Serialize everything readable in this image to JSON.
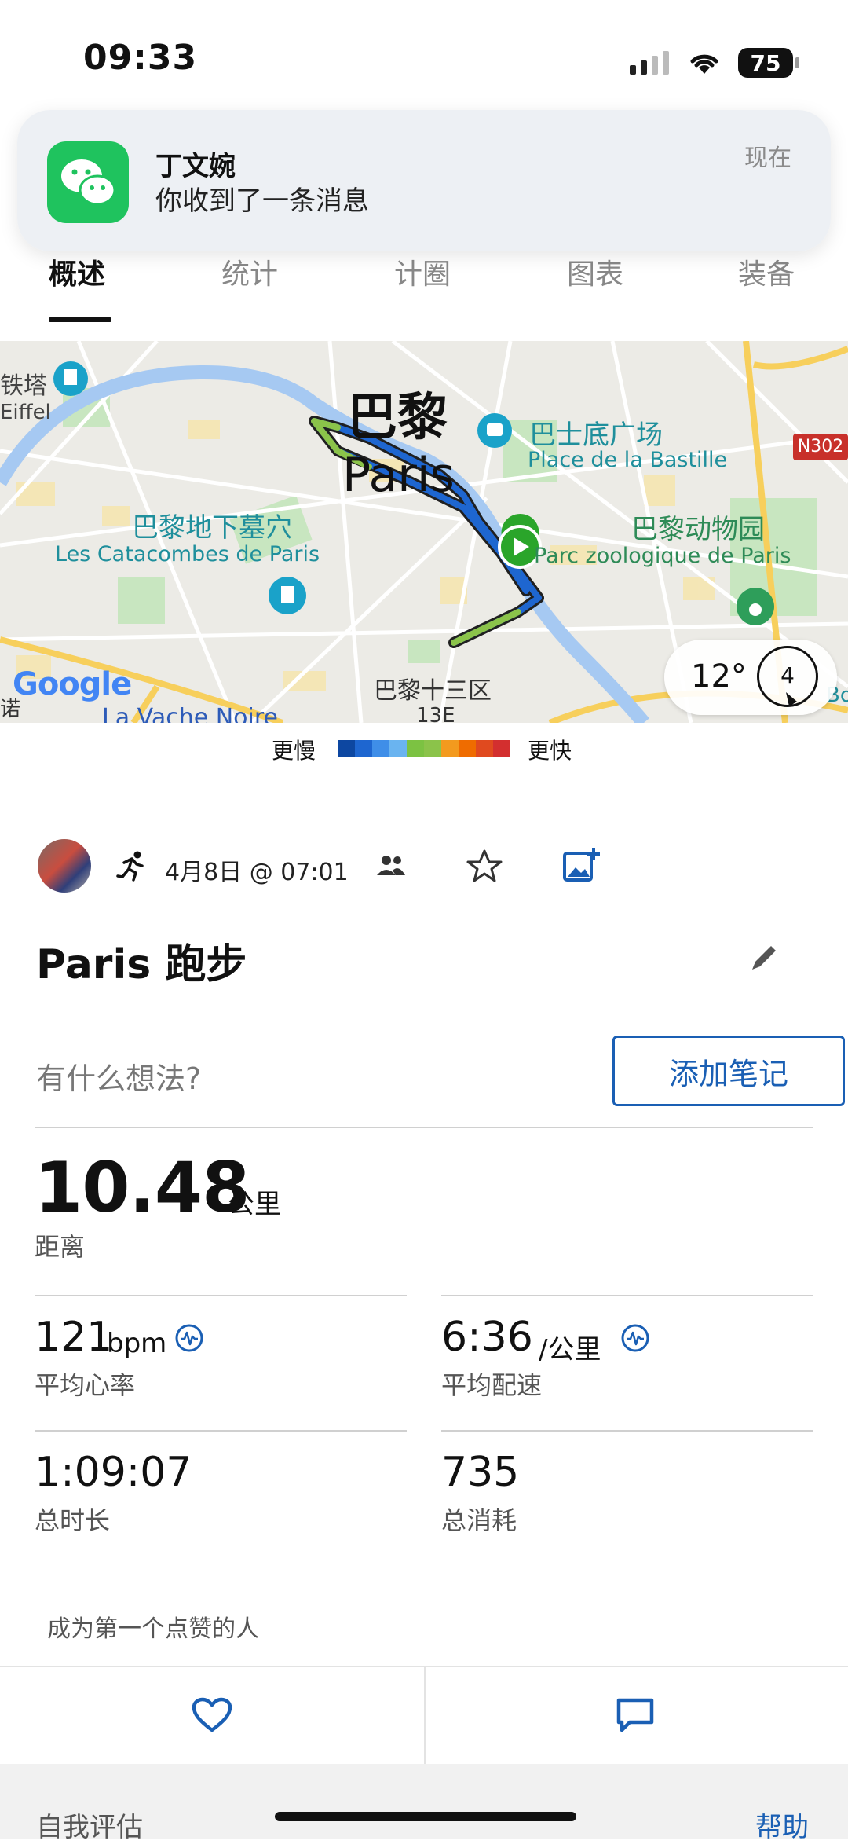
{
  "status_bar": {
    "time": "09:33",
    "battery": "75"
  },
  "notification": {
    "app_icon": "wechat-icon",
    "title": "丁文婉",
    "body": "你收到了一条消息",
    "time": "现在"
  },
  "tabs": [
    {
      "label": "概述",
      "active": true
    },
    {
      "label": "统计",
      "active": false
    },
    {
      "label": "计圈",
      "active": false
    },
    {
      "label": "图表",
      "active": false
    },
    {
      "label": "装备",
      "active": false
    }
  ],
  "map": {
    "labels": {
      "city_cn": "巴黎",
      "city_en": "Paris",
      "bastille_cn": "巴士底广场",
      "bastille_en": "Place de la Bastille",
      "catacombs_cn": "巴黎地下墓穴",
      "catacombs_en": "Les Catacombes de Paris",
      "zoo_cn": "巴黎动物园",
      "zoo_en": "Parc zoologique de Paris",
      "district_cn": "巴黎十三区",
      "district_code": "13E",
      "tower_partial": "铁塔",
      "eiffel_partial": "Eiffel",
      "road": "N302",
      "vache": "La Vache Noire",
      "left_edge": "诺",
      "brand": "Google",
      "right_edge": "Bo"
    },
    "weather": {
      "temp": "12°",
      "wind": "4"
    }
  },
  "legend": {
    "slower": "更慢",
    "faster": "更快",
    "colors": [
      "#0d47a1",
      "#1e66d0",
      "#3f8ee8",
      "#6ab4f0",
      "#7cc242",
      "#8bc34a",
      "#f39a1e",
      "#ef6c00",
      "#e04a1f",
      "#d32f2f"
    ]
  },
  "activity": {
    "date": "4月8日 @ 07:01",
    "title": "Paris 跑步",
    "note_placeholder": "有什么想法?",
    "add_note": "添加笔记"
  },
  "stats": {
    "distance": {
      "value": "10.48",
      "unit": "公里",
      "label": "距离"
    },
    "heart_rate": {
      "value": "121",
      "unit": "bpm",
      "label": "平均心率"
    },
    "pace": {
      "value": "6:36",
      "unit": "/公里",
      "label": "平均配速"
    },
    "duration": {
      "value": "1:09:07",
      "label": "总时长"
    },
    "calories": {
      "value": "735",
      "label": "总消耗"
    }
  },
  "social": {
    "likes_text": "成为第一个点赞的人"
  },
  "footer": {
    "left": "自我评估",
    "right": "帮助"
  }
}
